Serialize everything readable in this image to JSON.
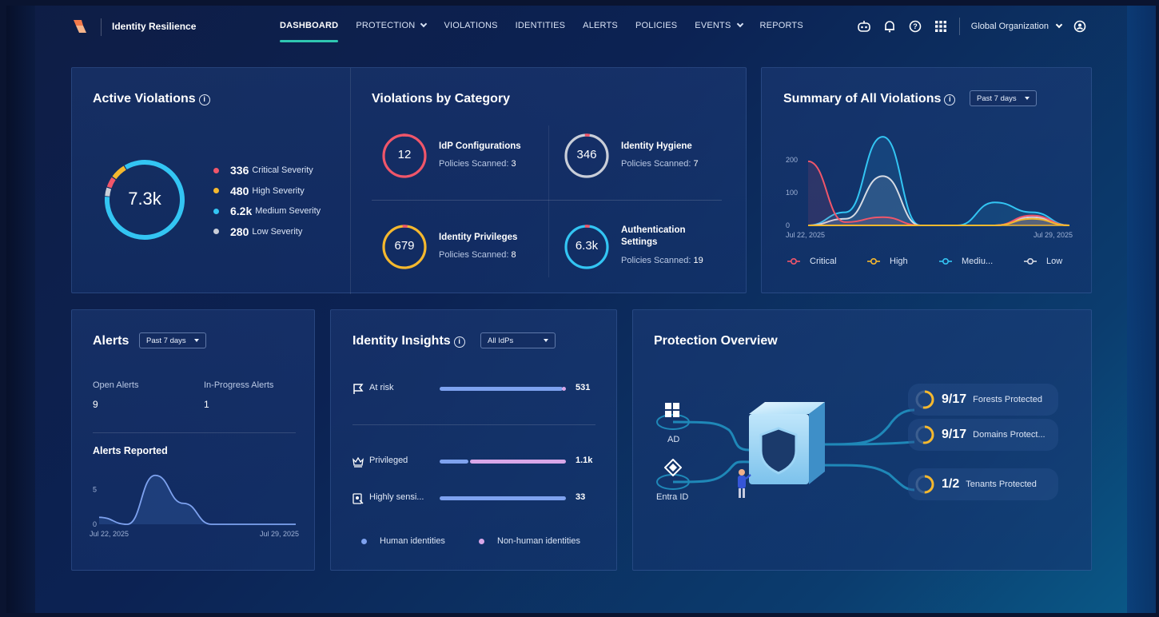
{
  "brand": {
    "name": "Identity Resilience"
  },
  "nav": {
    "items": [
      {
        "label": "DASHBOARD",
        "active": true,
        "dropdown": false
      },
      {
        "label": "PROTECTION",
        "active": false,
        "dropdown": true
      },
      {
        "label": "VIOLATIONS",
        "active": false,
        "dropdown": false
      },
      {
        "label": "IDENTITIES",
        "active": false,
        "dropdown": false
      },
      {
        "label": "ALERTS",
        "active": false,
        "dropdown": false
      },
      {
        "label": "POLICIES",
        "active": false,
        "dropdown": false
      },
      {
        "label": "EVENTS",
        "active": false,
        "dropdown": true
      },
      {
        "label": "REPORTS",
        "active": false,
        "dropdown": false
      }
    ],
    "org": "Global Organization",
    "icons": [
      "assistant-icon",
      "bell-icon",
      "help-icon",
      "apps-grid-icon",
      "user-icon"
    ]
  },
  "active_violations": {
    "title": "Active Violations",
    "total": "7.3k",
    "rows": [
      {
        "value": "336",
        "label": "Critical Severity",
        "color": "#f0566a"
      },
      {
        "value": "480",
        "label": "High Severity",
        "color": "#f5b82e"
      },
      {
        "value": "6.2k",
        "label": "Medium Severity",
        "color": "#33c5f3"
      },
      {
        "value": "280",
        "label": "Low Severity",
        "color": "#c9ced8"
      }
    ]
  },
  "violations_by_category": {
    "title": "Violations by Category",
    "items": [
      {
        "value": "12",
        "name": "IdP Configurations",
        "sub": "Policies Scanned:",
        "count": "3",
        "color": "#f0566a"
      },
      {
        "value": "346",
        "name": "Identity Hygiene",
        "sub": "Policies Scanned:",
        "count": "7",
        "color": "#c9ced8"
      },
      {
        "value": "679",
        "name": "Identity Privileges",
        "sub": "Policies Scanned:",
        "count": "8",
        "color": "#f5b82e"
      },
      {
        "value": "6.3k",
        "name": "Authentication Settings",
        "sub": "Policies Scanned:",
        "count": "19",
        "color": "#33c5f3"
      }
    ]
  },
  "summary": {
    "title": "Summary of All Violations",
    "range": "Past 7 days",
    "legend": [
      {
        "label": "Critical",
        "color": "#f0566a"
      },
      {
        "label": "High",
        "color": "#f5b82e"
      },
      {
        "label": "Mediu...",
        "color": "#33c5f3"
      },
      {
        "label": "Low",
        "color": "#d6dbe4"
      }
    ],
    "chart_data": {
      "type": "area",
      "x": [
        "Jul 22, 2025",
        "Jul 23, 2025",
        "Jul 24, 2025",
        "Jul 25, 2025",
        "Jul 26, 2025",
        "Jul 27, 2025",
        "Jul 28, 2025",
        "Jul 29, 2025"
      ],
      "xtick_labels": [
        "Jul 22, 2025",
        "Jul 29, 2025"
      ],
      "yticks": [
        "0",
        "100",
        "200"
      ],
      "ylim": [
        0,
        280
      ],
      "series": [
        {
          "name": "Critical",
          "values": [
            195,
            10,
            25,
            0,
            0,
            0,
            30,
            0
          ]
        },
        {
          "name": "High",
          "values": [
            0,
            0,
            0,
            0,
            0,
            0,
            20,
            0
          ]
        },
        {
          "name": "Mediu...",
          "values": [
            0,
            40,
            270,
            0,
            0,
            70,
            40,
            0
          ]
        },
        {
          "name": "Low",
          "values": [
            0,
            20,
            150,
            0,
            0,
            0,
            25,
            0
          ]
        }
      ]
    }
  },
  "alerts": {
    "title": "Alerts",
    "range": "Past 7 days",
    "open_label": "Open Alerts",
    "open_value": "9",
    "progress_label": "In-Progress Alerts",
    "progress_value": "1",
    "reported_title": "Alerts Reported",
    "chart_data": {
      "type": "area",
      "x": [
        "Jul 22, 2025",
        "Jul 23, 2025",
        "Jul 24, 2025",
        "Jul 25, 2025",
        "Jul 26, 2025",
        "Jul 27, 2025",
        "Jul 28, 2025",
        "Jul 29, 2025"
      ],
      "xtick_labels": [
        "Jul 22, 2025",
        "Jul 29, 2025"
      ],
      "yticks": [
        "0",
        "5"
      ],
      "ylim": [
        0,
        8
      ],
      "values": [
        1,
        0,
        7,
        3,
        0,
        0,
        0,
        0
      ]
    }
  },
  "identity_insights": {
    "title": "Identity Insights",
    "filter": "All IdPs",
    "rows": [
      {
        "label": "At risk",
        "value": "531",
        "human_frac": 0.99,
        "nonhuman_frac": 0.01,
        "icon": "flag-icon"
      },
      {
        "label": "Privileged",
        "value": "1.1k",
        "human_frac": 0.24,
        "nonhuman_frac": 0.76,
        "icon": "crown-icon"
      },
      {
        "label": "Highly sensi...",
        "value": "33",
        "human_frac": 1.0,
        "nonhuman_frac": 0,
        "icon": "sensitive-id-icon"
      }
    ],
    "legend": [
      {
        "label": "Human identities",
        "color": "#7ea2ef"
      },
      {
        "label": "Non-human identities",
        "color": "#d8a7e8"
      }
    ]
  },
  "protection": {
    "title": "Protection Overview",
    "sources": [
      {
        "label": "AD",
        "icon": "windows-icon"
      },
      {
        "label": "Entra ID",
        "icon": "entra-icon"
      }
    ],
    "rows": [
      {
        "value": "9/17",
        "label": "Forests Protected",
        "frac": 0.53
      },
      {
        "value": "9/17",
        "label": "Domains Protect...",
        "frac": 0.53
      },
      {
        "value": "1/2",
        "label": "Tenants Protected",
        "frac": 0.5
      }
    ]
  }
}
